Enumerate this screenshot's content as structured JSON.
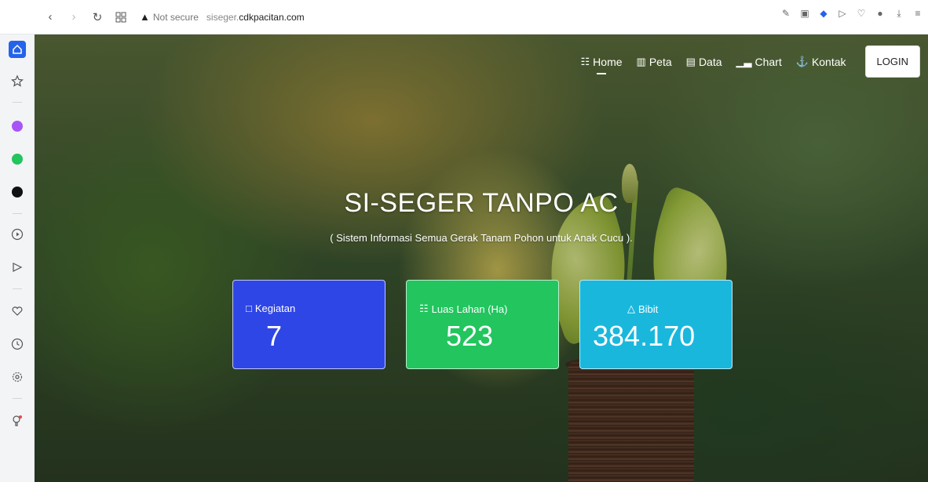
{
  "browser": {
    "security_label": "Not secure",
    "url_subdomain": "siseger.",
    "url_domain": "cdkpacitan.com"
  },
  "nav": {
    "items": [
      {
        "label": "Home",
        "icon": "chart-icon"
      },
      {
        "label": "Peta",
        "icon": "map-icon"
      },
      {
        "label": "Data",
        "icon": "file-icon"
      },
      {
        "label": "Chart",
        "icon": "bar-chart-icon"
      },
      {
        "label": "Kontak",
        "icon": "anchor-icon"
      }
    ],
    "login_label": "LOGIN"
  },
  "hero": {
    "title": "SI-SEGER TANPO AC",
    "subtitle": "( Sistem Informasi Semua Gerak Tanam Pohon untuk Anak Cucu )."
  },
  "stats": [
    {
      "label": "Kegiatan",
      "value": "7",
      "color": "#2f46e6"
    },
    {
      "label": "Luas Lahan (Ha)",
      "value": "523",
      "color": "#22c55e"
    },
    {
      "label": "Bibit",
      "value": "384.170",
      "color": "#1ab7dd"
    }
  ]
}
